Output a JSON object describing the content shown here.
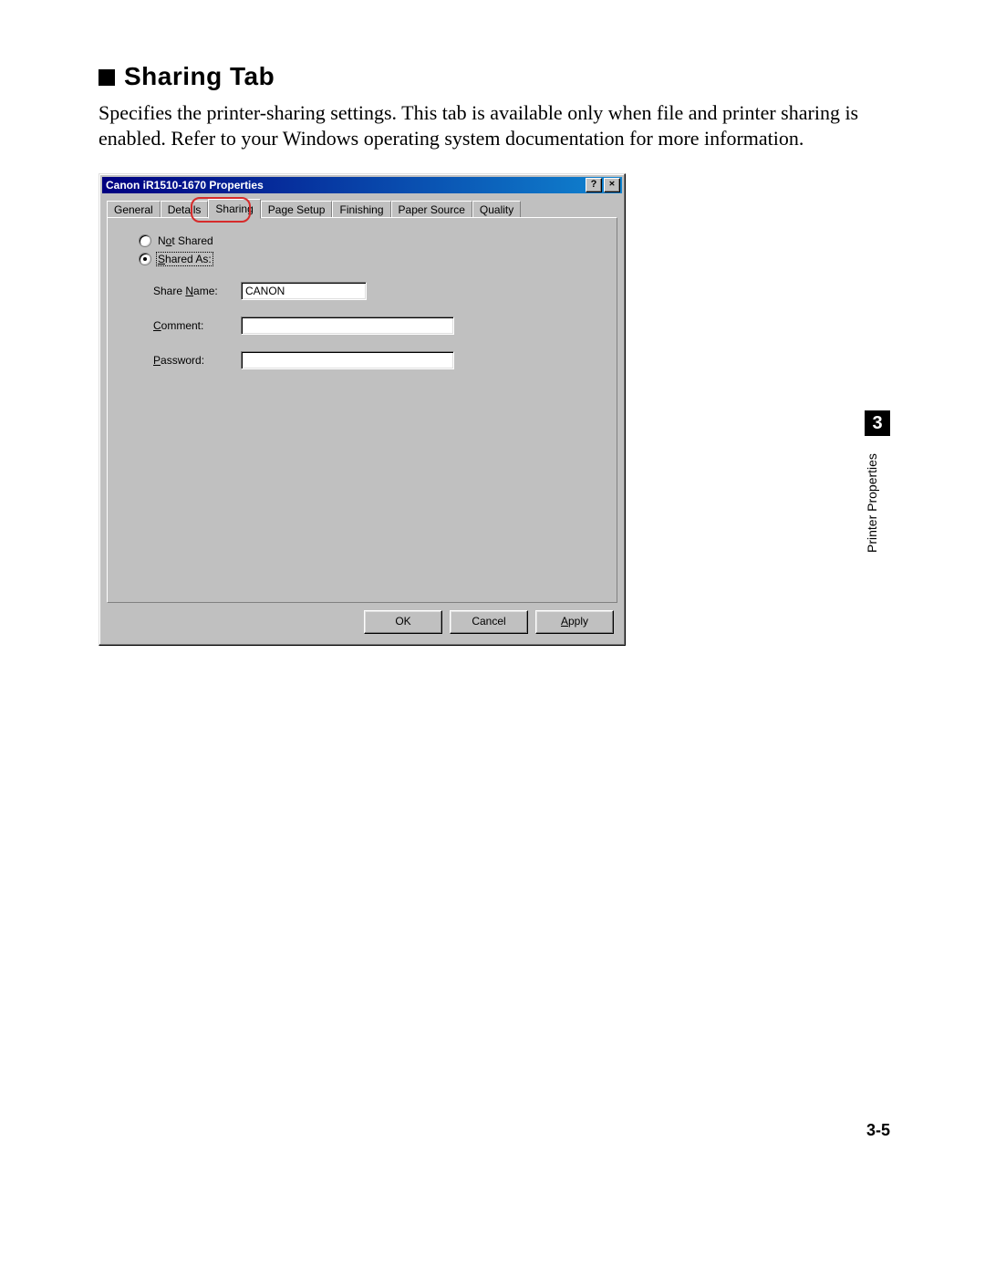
{
  "heading": "Sharing Tab",
  "body_text": "Specifies the printer-sharing settings. This tab is available only when file and printer sharing is enabled. Refer to your Windows operating system documentation for more information.",
  "dialog": {
    "title": "Canon iR1510-1670 Properties",
    "help_glyph": "?",
    "close_glyph": "×",
    "tabs": [
      "General",
      "Details",
      "Sharing",
      "Page Setup",
      "Finishing",
      "Paper Source",
      "Quality"
    ],
    "active_tab_index": 2,
    "radios": {
      "not_shared": {
        "label_pre": "N",
        "label_ul": "o",
        "label_post": "t Shared",
        "checked": false
      },
      "shared_as": {
        "label_pre": "",
        "label_ul": "S",
        "label_post": "hared As:",
        "checked": true
      }
    },
    "fields": {
      "share_name": {
        "label_pre": "Share ",
        "label_ul": "N",
        "label_post": "ame:",
        "value": "CANON"
      },
      "comment": {
        "label_pre": "",
        "label_ul": "C",
        "label_post": "omment:",
        "value": ""
      },
      "password": {
        "label_pre": "",
        "label_ul": "P",
        "label_post": "assword:",
        "value": ""
      }
    },
    "buttons": {
      "ok": "OK",
      "cancel": "Cancel",
      "apply_pre": "",
      "apply_ul": "A",
      "apply_post": "pply"
    }
  },
  "side": {
    "chapter_num": "3",
    "chapter_label": "Printer Properties",
    "page_num": "3-5"
  }
}
